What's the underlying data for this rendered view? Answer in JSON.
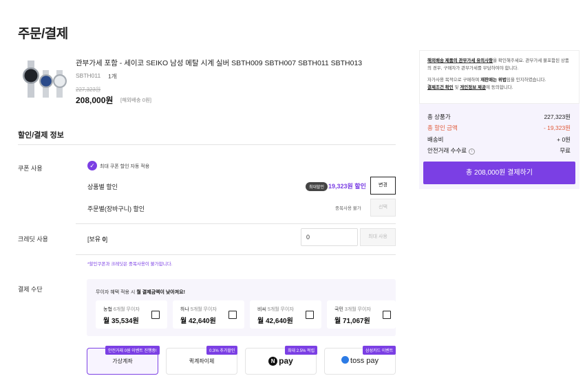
{
  "page": {
    "title": "주문/결제"
  },
  "product": {
    "name": "관부가세 포함 - 세이코 SEIKO 남성 메탈 시계 실버 SBTH009 SBTH007 SBTH011 SBTH013",
    "option": "SBTH011",
    "quantity": "1개",
    "original_price": "227,323원",
    "price": "208,000원",
    "shipping": "[해외배송 0원]",
    "image_icon": "watch-product-image"
  },
  "discount_section": {
    "title": "할인/결제 정보",
    "coupon_label": "쿠폰 사용",
    "auto_coupon_text": "최대 쿠폰 할인 자동 적용",
    "product_discount_label": "상품별 할인",
    "max_badge": "최대할인",
    "product_discount_amount": "19,323원 할인",
    "change_button": "변경",
    "order_discount_label": "주문별(장바구니) 할인",
    "duplicate_text": "중복사용 불가",
    "select_button": "선택",
    "credit_label": "크레딧 사용",
    "credit_balance_prefix": "[보유 ",
    "credit_balance_value": "0",
    "credit_balance_suffix": "]",
    "credit_input_value": "0",
    "credit_max_button": "최대 사용",
    "notice": "*할인쿠폰과 크레딧은 중복사용이 불가합니다."
  },
  "payment": {
    "label": "결제 수단",
    "installment_header_prefix": "무이자 혜택 적용 시 ",
    "installment_header_bold": "월 결제금액이 낮아져요!",
    "installments": [
      {
        "bank": "농협",
        "months": "6개월 무이자",
        "amount": "월 35,534원"
      },
      {
        "bank": "하나",
        "months": "5개월 무이자",
        "amount": "월 42,640원"
      },
      {
        "bank": "비씨",
        "months": "5개월 무이자",
        "amount": "월 42,640원"
      },
      {
        "bank": "국민",
        "months": "3개월 무이자",
        "amount": "월 71,067원"
      }
    ],
    "methods": [
      {
        "label": "가상계좌",
        "badge": "안전거래 0원 이벤트 진행중!"
      },
      {
        "label": "퀵계좌이체",
        "badge": "0.3% 추가할인"
      },
      {
        "label": "pay",
        "logo_letter": "N",
        "badge": "최대 2.5% 적립"
      },
      {
        "label": "toss pay",
        "badge": "삼성카드 이벤트"
      }
    ]
  },
  "side_notice": {
    "line1_link": "해외배송 제품의 관부가세 유의사항",
    "line1_rest": "을 확인해주세요. 관부가세 불포함된 상품의 경우, 구매자가 관부가세를 부담하여야 합니다.",
    "line2_pre": "자가사용 목적으로 구매하며 ",
    "line2_bold": "재판매는 위법",
    "line2_post": "임을 인지하였습니다.",
    "line3_link1": "결제조건 확인",
    "line3_mid": " 및 ",
    "line3_link2": "개인정보 제공",
    "line3_post": "에 동의합니다."
  },
  "summary": {
    "total_product_label": "총 상품가",
    "total_product_value": "227,323원",
    "total_discount_label": "총 할인 금액",
    "total_discount_value": "- 19,323원",
    "shipping_label": "배송비",
    "shipping_value": "+ 0원",
    "fee_label": "안전거래 수수료",
    "fee_value": "무료",
    "pay_button": "총 208,000원 결제하기"
  },
  "colors": {
    "accent": "#7b3fe4",
    "discount_red": "#e05a3a",
    "summary_bg": "#f6f3fd"
  }
}
